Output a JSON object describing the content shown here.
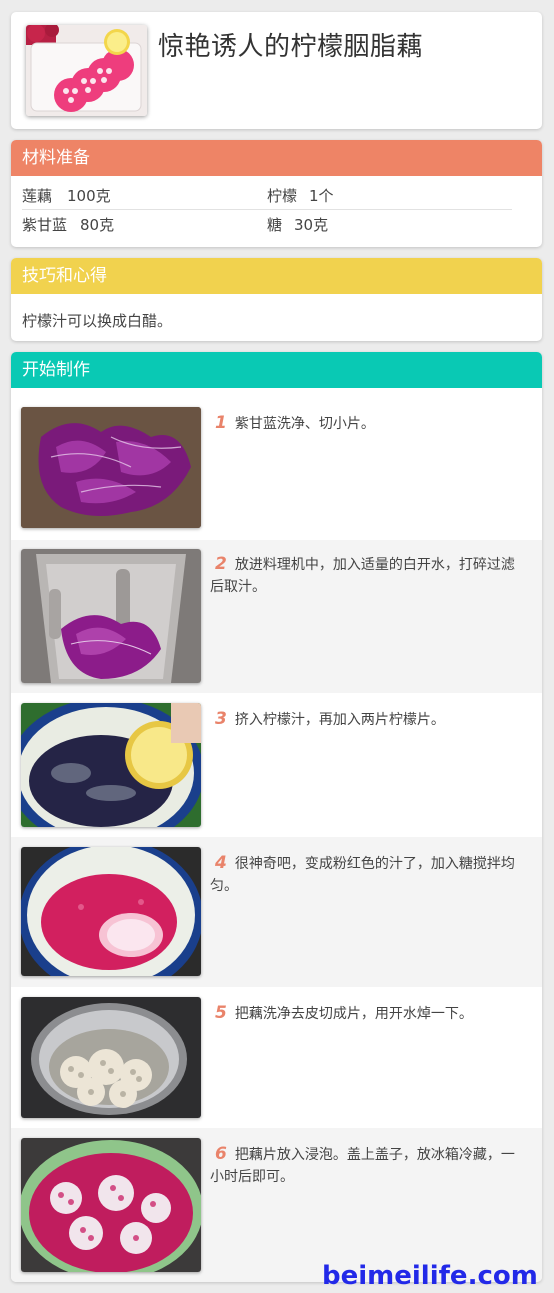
{
  "recipe": {
    "title": "惊艳诱人的柠檬胭脂藕"
  },
  "ingredients": {
    "heading": "材料准备",
    "heading_color": "#ee8466",
    "items": [
      {
        "name": "莲藕",
        "amount": "100克"
      },
      {
        "name": "柠檬",
        "amount": "1个"
      },
      {
        "name": "紫甘蓝",
        "amount": "80克"
      },
      {
        "name": "糖",
        "amount": "30克"
      }
    ]
  },
  "tips": {
    "heading": "技巧和心得",
    "heading_color": "#f1d24e",
    "text": "柠檬汁可以换成白醋。"
  },
  "steps": {
    "heading": "开始制作",
    "heading_color": "#09c9b4",
    "alt_row_color": "#f4f4f4",
    "items": [
      {
        "num": "1",
        "text": "紫甘蓝洗净、切小片。",
        "image": "purple-cabbage-photo"
      },
      {
        "num": "2",
        "text": "放进料理机中，加入适量的白开水，打碎过滤后取汁。",
        "image": "blender-photo"
      },
      {
        "num": "3",
        "text": "挤入柠檬汁，再加入两片柠檬片。",
        "image": "lemon-squeeze-photo"
      },
      {
        "num": "4",
        "text": "很神奇吧，变成粉红色的汁了，加入糖搅拌均匀。",
        "image": "pink-juice-photo"
      },
      {
        "num": "5",
        "text": "把藕洗净去皮切成片，用开水焯一下。",
        "image": "lotus-pot-photo"
      },
      {
        "num": "6",
        "text": "把藕片放入浸泡。盖上盖子，放冰箱冷藏，一小时后即可。",
        "image": "lotus-soak-photo"
      }
    ]
  },
  "watermark": "beimeilife.com"
}
